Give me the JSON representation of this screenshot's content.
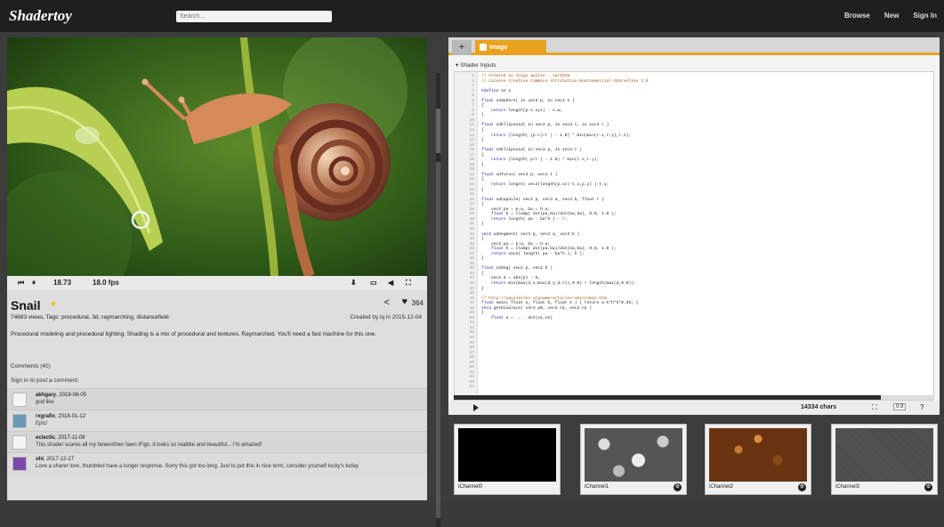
{
  "app": {
    "logo": "Shadertoy"
  },
  "search": {
    "placeholder": "Search..."
  },
  "nav": {
    "browse": "Browse",
    "new": "New",
    "signin": "Sign In"
  },
  "player": {
    "time": "18.73",
    "fps": "18.0 fps"
  },
  "shader": {
    "title": "Snail",
    "views_line": "74683 views, Tags: procedural, 3d, raymarching, distancefield",
    "created": "Created by iq in 2015-12-04",
    "likes": "364",
    "description": "Procedural modeling and procedural lighting. Shading is a mix of procedural and textures. Raymarched. You'll need a fast machine for this one."
  },
  "comments": {
    "header": "Comments (40)",
    "signin_text": "Sign in to post a comment.",
    "items": [
      {
        "user": "akhgary",
        "date": "2018-08-05",
        "text": "god like"
      },
      {
        "user": "rxgrafix",
        "date": "2018-01-12",
        "text": "Epic!"
      },
      {
        "user": "eclectic",
        "date": "2017-11-08",
        "text": "This shader scares all my fanworthier fawn iFigs, it looks so realtike and beautiful... I'm amazed!"
      },
      {
        "user": "ohl",
        "date": "2017-12-17",
        "text": "Love a sharer love, thumbted have a longer response. Sorry this got too long. Just to put this in nice term, consider yourself locky's today"
      }
    ]
  },
  "editor": {
    "tab_label": "Image",
    "inputs_label": "▾ Shader Inputs",
    "chars": "14334 chars",
    "foot_size": "0.9"
  },
  "channels": [
    {
      "label": "iChannel0"
    },
    {
      "label": "iChannel1"
    },
    {
      "label": "iChannel2"
    },
    {
      "label": "iChannel3"
    }
  ],
  "colors": {
    "accent": "#e8a21e",
    "topbar": "#1f1f1f"
  }
}
